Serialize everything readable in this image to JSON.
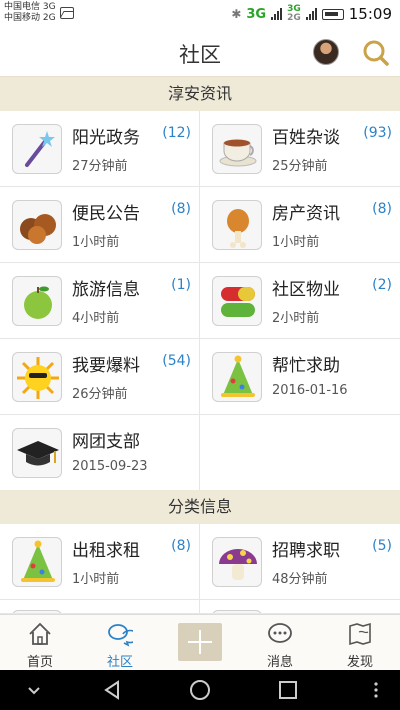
{
  "status_bar": {
    "carrier1": "中国电信 3G",
    "carrier2": "中国移动 2G",
    "net1": "3G",
    "net2": "3G",
    "net3": "2G",
    "time": "15:09"
  },
  "header": {
    "title": "社区"
  },
  "sections": [
    {
      "title": "淳安资讯"
    },
    {
      "title": "分类信息"
    }
  ],
  "items": [
    {
      "title": "阳光政务",
      "time": "27分钟前",
      "count": "12",
      "icon": "magic-wand-icon"
    },
    {
      "title": "百姓杂谈",
      "time": "25分钟前",
      "count": "93",
      "icon": "teacup-icon"
    },
    {
      "title": "便民公告",
      "time": "1小时前",
      "count": "8",
      "icon": "chestnuts-icon"
    },
    {
      "title": "房产资讯",
      "time": "1小时前",
      "count": "8",
      "icon": "roast-chicken-icon"
    },
    {
      "title": "旅游信息",
      "time": "4小时前",
      "count": "1",
      "icon": "green-apple-icon"
    },
    {
      "title": "社区物业",
      "time": "2小时前",
      "count": "2",
      "icon": "capsule-icon"
    },
    {
      "title": "我要爆料",
      "time": "26分钟前",
      "count": "54",
      "icon": "sun-icon"
    },
    {
      "title": "帮忙求助",
      "time": "2016-01-16",
      "count": "",
      "icon": "party-hat-icon"
    },
    {
      "title": "网团支部",
      "time": "2015-09-23",
      "count": "",
      "icon": "graduation-cap-icon"
    }
  ],
  "classified": [
    {
      "title": "出租求租",
      "time": "1小时前",
      "count": "8",
      "icon": "party-hat-icon"
    },
    {
      "title": "招聘求职",
      "time": "48分钟前",
      "count": "5",
      "icon": "mushroom-icon"
    }
  ],
  "tabs": [
    {
      "label": "首页",
      "icon": "home-icon",
      "active": false
    },
    {
      "label": "社区",
      "icon": "chat-bubbles-icon",
      "active": true
    },
    {
      "label": "消息",
      "icon": "message-icon",
      "active": false
    },
    {
      "label": "发现",
      "icon": "map-icon",
      "active": false
    }
  ],
  "colors": {
    "accent": "#2b82c9",
    "section_bg": "#efe9d8",
    "search_icon": "#c9a24a"
  }
}
